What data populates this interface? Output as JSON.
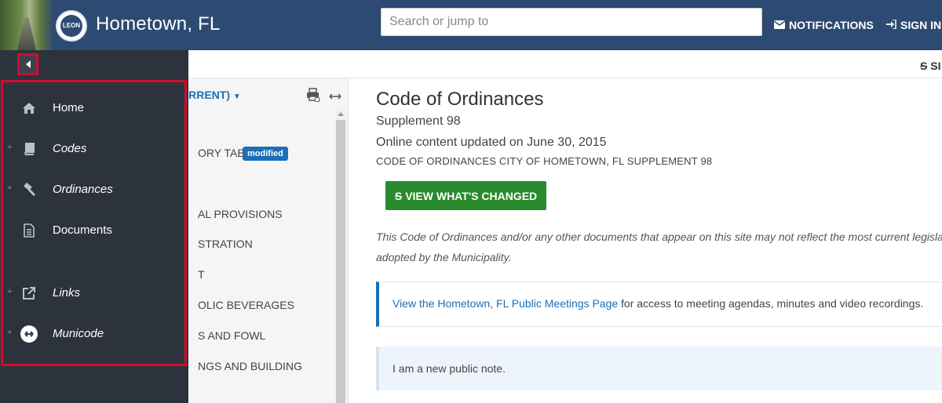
{
  "header": {
    "site_title": "Hometown, FL",
    "seal_text": "LEON",
    "search_placeholder": "Search or jump to",
    "notifications_label": "NOTIFICATIONS",
    "signin_label": "SIGN IN"
  },
  "toolbar": {
    "top_right_label": "SI"
  },
  "toc": {
    "version_label": "URRENT)",
    "items": [
      "ORY TABLE",
      "AL PROVISIONS",
      "STRATION",
      "T",
      "OLIC BEVERAGES",
      "S AND FOWL",
      "NGS AND BUILDING"
    ],
    "modified_badge": "modified"
  },
  "main": {
    "title": "Code of Ordinances",
    "supplement": "Supplement 98",
    "updated": "Online content updated on June 30, 2015",
    "code_line": "CODE OF ORDINANCES CITY OF HOMETOWN, FL SUPPLEMENT 98",
    "changes_button": "VIEW WHAT'S CHANGED",
    "disclaimer": "This Code of Ordinances and/or any other documents that appear on this site may not reflect the most current legislation adopted by the Municipality.",
    "meetings_link": "View the Hometown, FL Public Meetings Page",
    "meetings_text": " for access to meeting agendas, minutes and video recordings.",
    "note": "I am a new public note."
  },
  "sidemenu": {
    "items": [
      {
        "label": "Home",
        "icon": "home-icon",
        "italic": false,
        "expandable": false
      },
      {
        "label": "Codes",
        "icon": "book-icon",
        "italic": true,
        "expandable": true
      },
      {
        "label": "Ordinances",
        "icon": "gavel-icon",
        "italic": true,
        "expandable": true
      },
      {
        "label": "Documents",
        "icon": "document-icon",
        "italic": false,
        "expandable": false
      },
      {
        "label": "Links",
        "icon": "external-link-icon",
        "italic": true,
        "expandable": true
      },
      {
        "label": "Municode",
        "icon": "municode-logo-icon",
        "italic": true,
        "expandable": true
      }
    ]
  },
  "colors": {
    "header_bg": "#2d4a72",
    "menu_bg": "#2c333d",
    "highlight_red": "#d00d2d",
    "link_blue": "#1b6fb8",
    "button_green": "#2a8a2e"
  }
}
